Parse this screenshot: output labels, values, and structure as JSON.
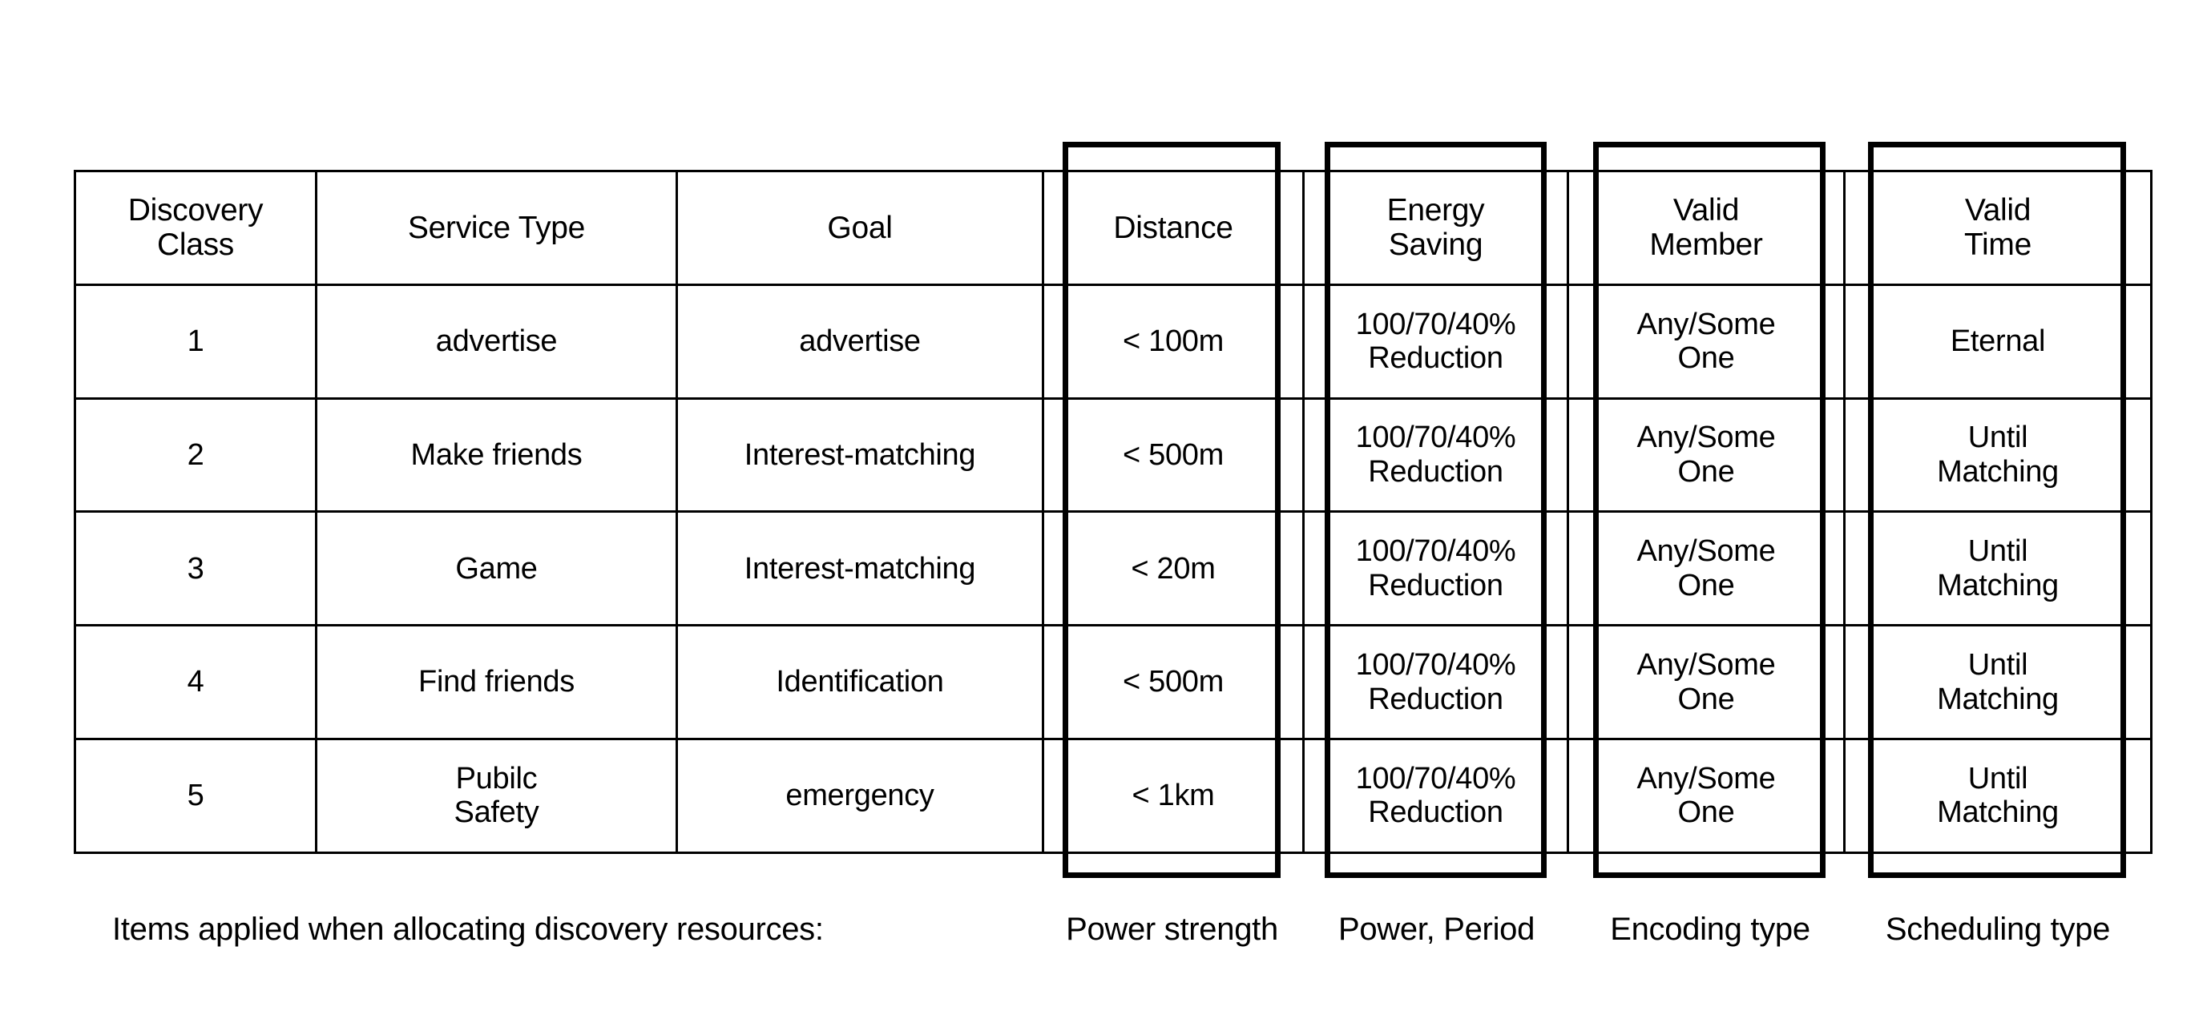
{
  "figure": {
    "kind": "table-diagram",
    "caption_main": "Items applied when allocating discovery resources:"
  },
  "table": {
    "headers": [
      "Discovery\nClass",
      "Service Type",
      "Goal",
      "Distance",
      "Energy\nSaving",
      "Valid\nMember",
      "Valid\nTime"
    ],
    "headers_line": {
      "h1a": "Discovery",
      "h1b": "Class",
      "h2": "Service Type",
      "h3": "Goal",
      "h4": "Distance",
      "h5a": "Energy",
      "h5b": "Saving",
      "h6a": "Valid",
      "h6b": "Member",
      "h7a": "Valid",
      "h7b": "Time"
    },
    "rows": [
      {
        "discovery_class": "1",
        "service_type": "advertise",
        "goal": "advertise",
        "distance": "< 100m",
        "energy_saving_a": "100/70/40%",
        "energy_saving_b": "Reduction",
        "valid_member_a": "Any/Some",
        "valid_member_b": "One",
        "valid_time_a": "Eternal",
        "valid_time_b": ""
      },
      {
        "discovery_class": "2",
        "service_type": "Make friends",
        "goal": "Interest-matching",
        "distance": "< 500m",
        "energy_saving_a": "100/70/40%",
        "energy_saving_b": "Reduction",
        "valid_member_a": "Any/Some",
        "valid_member_b": "One",
        "valid_time_a": "Until",
        "valid_time_b": "Matching"
      },
      {
        "discovery_class": "3",
        "service_type": "Game",
        "goal": "Interest-matching",
        "distance": "< 20m",
        "energy_saving_a": "100/70/40%",
        "energy_saving_b": "Reduction",
        "valid_member_a": "Any/Some",
        "valid_member_b": "One",
        "valid_time_a": "Until",
        "valid_time_b": "Matching"
      },
      {
        "discovery_class": "4",
        "service_type": "Find friends",
        "goal": "Identification",
        "distance": "< 500m",
        "energy_saving_a": "100/70/40%",
        "energy_saving_b": "Reduction",
        "valid_member_a": "Any/Some",
        "valid_member_b": "One",
        "valid_time_a": "Until",
        "valid_time_b": "Matching"
      },
      {
        "discovery_class": "5",
        "service_type_a": "Pubilc",
        "service_type_b": "Safety",
        "goal": "emergency",
        "distance": "< 1km",
        "energy_saving_a": "100/70/40%",
        "energy_saving_b": "Reduction",
        "valid_member_a": "Any/Some",
        "valid_member_b": "One",
        "valid_time_a": "Until",
        "valid_time_b": "Matching"
      }
    ]
  },
  "callouts": [
    {
      "id": "distance",
      "column_header": "Distance",
      "label": "Power strength"
    },
    {
      "id": "energy",
      "column_header": "Energy Saving",
      "label": "Power, Period"
    },
    {
      "id": "member",
      "column_header": "Valid Member",
      "label": "Encoding type"
    },
    {
      "id": "time",
      "column_header": "Valid Time",
      "label": "Scheduling type"
    }
  ],
  "colors": {
    "ink": "#000000",
    "paper": "#ffffff"
  }
}
